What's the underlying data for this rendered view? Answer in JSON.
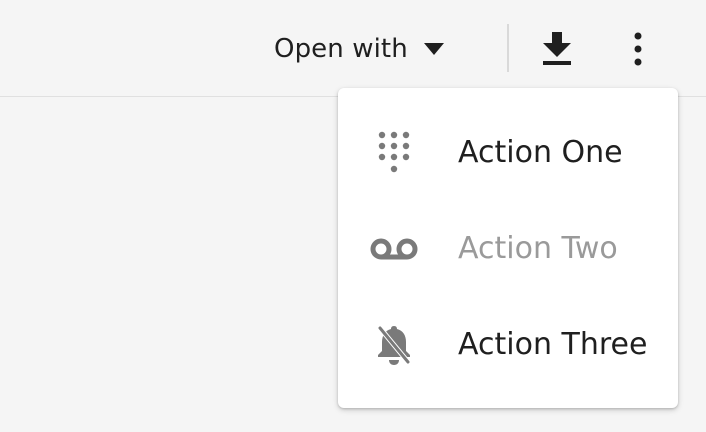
{
  "toolbar": {
    "open_with_label": "Open with",
    "icons": {
      "open_with_dropdown": "chevron-down-icon",
      "download": "download-icon",
      "more": "more-vertical-icon"
    }
  },
  "menu": {
    "items": [
      {
        "label": "Action One",
        "icon": "dialpad-icon",
        "disabled": false
      },
      {
        "label": "Action Two",
        "icon": "voicemail-icon",
        "disabled": true
      },
      {
        "label": "Action Three",
        "icon": "notifications-off-icon",
        "disabled": false
      }
    ]
  },
  "colors": {
    "background": "#f5f5f5",
    "menu_background": "#ffffff",
    "text": "#1f1f1f",
    "disabled_text": "#9a9a9a",
    "icon": "#7a7a7a"
  }
}
